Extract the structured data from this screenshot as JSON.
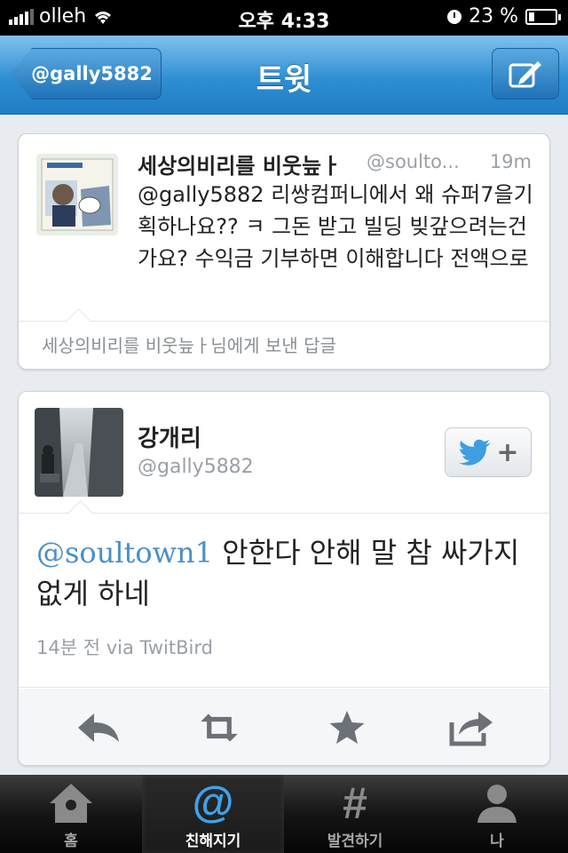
{
  "status_bar": {
    "carrier": "olleh",
    "time": "오후 4:33",
    "battery": "23 %",
    "battery_level": 0.23
  },
  "nav": {
    "back_label": "@gally5882",
    "title": "트윗"
  },
  "reply_card": {
    "name": "세상의비리를 비웃늪ㅏ",
    "handle": "@soulto...",
    "time": "19m",
    "text": "@gally5882 리쌍컴퍼니에서 왜 슈퍼7을기획하나요?? ㅋ 그돈 받고 빌딩 빚갚으려는건가요? 수익금 기부하면 이해합니다 전액으로",
    "footer": "세상의비리를 비웃늪ㅏ님에게 보낸 답글"
  },
  "tweet_card": {
    "name": "강개리",
    "handle": "@gally5882",
    "mention": "@soultown1",
    "text": "안한다 안해 말 참 싸가지 없게 하네",
    "meta": "14분 전 via TwitBird"
  },
  "tabs": [
    {
      "label": "홈",
      "icon": "home-icon"
    },
    {
      "label": "친해지기",
      "icon": "at-icon",
      "active": true
    },
    {
      "label": "발견하기",
      "icon": "hash-icon"
    },
    {
      "label": "나",
      "icon": "person-icon"
    }
  ],
  "colors": {
    "nav_blue": "#2f8fd3",
    "mention_blue": "#4a8fc9",
    "active_tab_blue": "#3ea2ec"
  }
}
